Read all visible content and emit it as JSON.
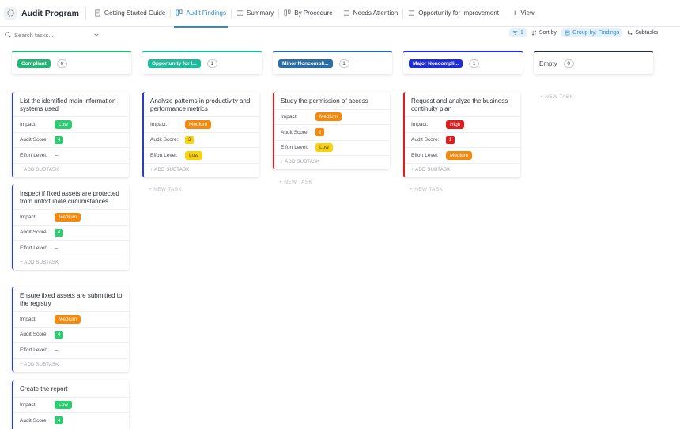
{
  "app": {
    "title": "Audit Program"
  },
  "tabs": [
    {
      "label": "Getting Started Guide",
      "icon": "doc-icon"
    },
    {
      "label": "Audit Findings",
      "icon": "board-icon",
      "active": true
    },
    {
      "label": "Summary",
      "icon": "list-icon"
    },
    {
      "label": "By Procedure",
      "icon": "board-icon"
    },
    {
      "label": "Needs Attention",
      "icon": "list-icon"
    },
    {
      "label": "Opportunity for Improvement",
      "icon": "list-icon"
    }
  ],
  "view_button": "View",
  "toolbar": {
    "search_placeholder": "Search tasks...",
    "filter_count": "1",
    "sort_label": "Sort by",
    "group_label": "Group by: Findings",
    "subtasks_label": "Subtasks"
  },
  "labels": {
    "impact": "Impact:",
    "audit_score": "Audit Score:",
    "effort_level": "Effort Level:",
    "add_subtask": "+ ADD SUBTASK",
    "new_task": "+ NEW TASK"
  },
  "colors": {
    "compliant": "#22b573",
    "opportunity": "#1bbc9c",
    "minor": "#2b6ea6",
    "major": "#1c2dd9",
    "low": "#2ecc71",
    "medium": "#f5890d",
    "high": "#e01d1d",
    "yellow": "#f7d30f"
  },
  "columns": [
    {
      "name": "Compliant",
      "count": "6",
      "color": "#22b573"
    },
    {
      "name": "Opportunity for I...",
      "count": "1",
      "color": "#1bbc9c"
    },
    {
      "name": "Minor Noncompli...",
      "count": "1",
      "color": "#2b6ea6"
    },
    {
      "name": "Major Noncompli...",
      "count": "1",
      "color": "#1c2dd9"
    },
    {
      "name": "Empty",
      "count": "0"
    }
  ],
  "cards": {
    "c1": {
      "title": "List the identified main information systems used",
      "impact": "Low",
      "score": "4",
      "effort": "–"
    },
    "c2": {
      "title": "Inspect if fixed assets are protected from unfortunate circumstances",
      "impact": "Medium",
      "score": "4",
      "effort": "–"
    },
    "c3": {
      "title": "Ensure fixed assets are submitted to the registry",
      "impact": "Medium",
      "score": "4",
      "effort": "–"
    },
    "c4": {
      "title": "Create the report",
      "impact": "Low",
      "score": "4"
    },
    "o1": {
      "title": "Analyze patterns in productivity and performance metrics",
      "impact": "Medium",
      "score": "3",
      "effort": "Low"
    },
    "m1": {
      "title": "Study the permission of access",
      "impact": "Medium",
      "score": "2",
      "effort": "Low"
    },
    "j1": {
      "title": "Request and analyze the business continuity plan",
      "impact": "High",
      "score": "1",
      "effort": "Medium"
    }
  }
}
